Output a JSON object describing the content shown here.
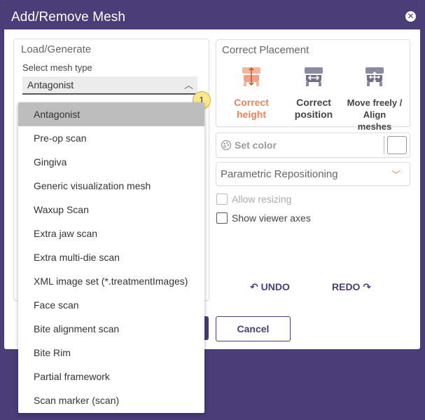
{
  "dialog": {
    "title": "Add/Remove Mesh",
    "close_icon": "close-icon"
  },
  "load_generate": {
    "title": "Load/Generate",
    "select_label": "Select mesh type",
    "selected_value": "Antagonist",
    "badge": "1"
  },
  "correct_placement": {
    "title": "Correct Placement",
    "options": [
      {
        "line1": "Correct",
        "line2": "height",
        "icon": "height-tooth-icon",
        "active": true
      },
      {
        "line1": "Correct",
        "line2": "position",
        "icon": "position-tooth-icon",
        "active": false
      },
      {
        "line1": "Move freely /",
        "line2": "Align meshes",
        "icon": "move-tooth-icon",
        "active": false
      }
    ]
  },
  "set_color": {
    "label": "Set color",
    "icon": "palette-icon"
  },
  "parametric": {
    "label": "Parametric Repositioning"
  },
  "checkboxes": {
    "allow_resizing": "Allow resizing",
    "show_axes": "Show viewer axes"
  },
  "history": {
    "undo": "UNDO",
    "redo": "REDO"
  },
  "footer": {
    "cancel": "Cancel"
  },
  "dropdown": {
    "items": [
      "Antagonist",
      "Pre-op scan",
      "Gingiva",
      "Generic visualization mesh",
      "Waxup Scan",
      "Extra jaw scan",
      "Extra multi-die scan",
      "XML image set (*.treatmentImages)",
      "Face scan",
      "Bite alignment scan",
      "Bite Rim",
      "Partial framework",
      "Scan marker (scan)"
    ]
  },
  "colors": {
    "brand": "#4a3d78",
    "accent": "#e98459"
  }
}
